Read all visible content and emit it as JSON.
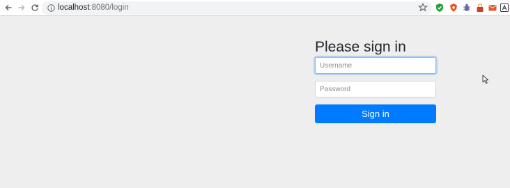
{
  "browser": {
    "url_host": "localhost",
    "url_path": ":8080/login",
    "icons": [
      "back-icon",
      "forward-icon",
      "reload-icon",
      "info-icon",
      "bookmark-star-icon",
      "extension-shield-icon",
      "extension-brave-icon",
      "extension-bug-icon",
      "extension-lock-icon",
      "extension-mail-icon",
      "extension-translate-icon"
    ]
  },
  "login": {
    "heading": "Please sign in",
    "username_placeholder": "Username",
    "password_placeholder": "Password",
    "submit_label": "Sign in"
  },
  "colors": {
    "page_background": "#eeeeee",
    "primary": "#007bff",
    "text": "#212529"
  }
}
